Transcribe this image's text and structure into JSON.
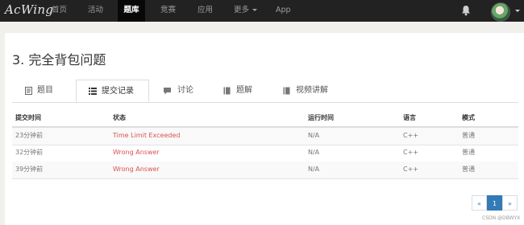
{
  "nav": {
    "logo": "AcWing",
    "items": [
      "首页",
      "活动",
      "题库",
      "竞赛",
      "应用",
      "更多",
      "App"
    ],
    "active_index": 2
  },
  "problem": {
    "title": "3. 完全背包问题"
  },
  "tabs": [
    {
      "label": "题目",
      "icon": "file-icon"
    },
    {
      "label": "提交记录",
      "icon": "list-icon"
    },
    {
      "label": "讨论",
      "icon": "comment-icon"
    },
    {
      "label": "题解",
      "icon": "book-icon"
    },
    {
      "label": "视频讲解",
      "icon": "book-icon"
    }
  ],
  "active_tab": 1,
  "table": {
    "headers": [
      "提交时间",
      "状态",
      "运行时间",
      "语言",
      "模式"
    ],
    "rows": [
      {
        "time": "23分钟前",
        "status": "Time Limit Exceeded",
        "runtime": "N/A",
        "lang": "C++",
        "mode": "普通"
      },
      {
        "time": "32分钟前",
        "status": "Wrong Answer",
        "runtime": "N/A",
        "lang": "C++",
        "mode": "普通"
      },
      {
        "time": "39分钟前",
        "status": "Wrong Answer",
        "runtime": "N/A",
        "lang": "C++",
        "mode": "普通"
      }
    ]
  },
  "pagination": {
    "prev": "«",
    "current": "1",
    "next": "»"
  },
  "watermark": "CSDN @DBWYX",
  "colors": {
    "navbar": "#222222",
    "status_error": "#d9534f",
    "accent": "#337ab7"
  }
}
